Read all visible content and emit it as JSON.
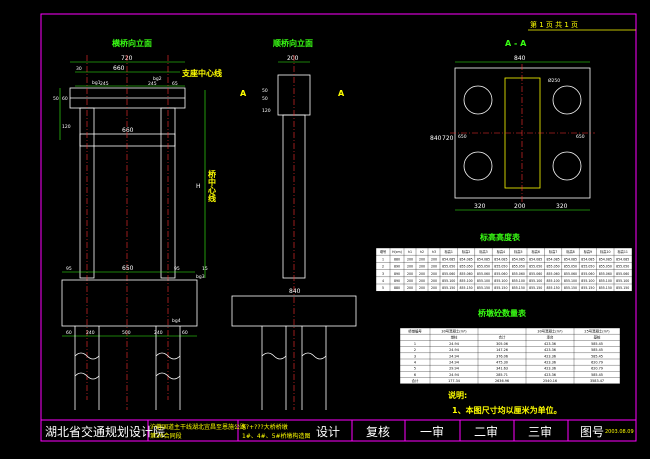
{
  "page_header": {
    "sheet": "第 1 页 共 1 页"
  },
  "views": {
    "transverse": {
      "title": "横桥向立面",
      "support_center": "支座中心线",
      "pier_center": "桥中心线",
      "height_mark": "H",
      "dims": {
        "top_width": "720",
        "top_inner": "660",
        "top_left": "30",
        "bg2_left": "245",
        "bg2_right": "245",
        "bg2_end": "65",
        "column_width": "660",
        "left_v1": "50",
        "left_v2": "60",
        "left_v3": "120",
        "base_left": "95",
        "base_mid": "650",
        "base_right": "95",
        "base_end": "15",
        "foot_a": "60",
        "foot_b": "240",
        "foot_c": "500",
        "foot_d": "240",
        "foot_e": "60"
      },
      "rebar_marks": {
        "bg1_a": "bg1",
        "bg2": "bg2",
        "bg3": "bg3",
        "bg4": "bg4"
      }
    },
    "longitudinal": {
      "title": "顺桥向立面",
      "width": "200",
      "v1": "50",
      "v2": "50",
      "v3": "120",
      "base_width": "840",
      "section_mark": "A"
    },
    "section": {
      "title": "A - A",
      "width": "840",
      "height": "840",
      "inner_h": "720",
      "left": "320",
      "mid": "200",
      "right": "320",
      "dia": "Ø250",
      "h1": "650",
      "h2": "650"
    }
  },
  "elevation_table": {
    "title": "标高高度表",
    "headers": [
      "墩号",
      "H(cm)",
      "h1",
      "h2",
      "h3",
      "标高1",
      "标高2",
      "标高3",
      "标高4",
      "标高5",
      "标高6",
      "标高7",
      "标高8",
      "标高9",
      "标高10",
      "标高11"
    ],
    "rows": [
      [
        "1",
        "880",
        "200",
        "200",
        "200",
        "854.085",
        "854.085",
        "854.085",
        "854.085",
        "854.085",
        "854.085",
        "854.085",
        "854.085",
        "854.085",
        "854.085",
        "854.085"
      ],
      [
        "2",
        "890",
        "200",
        "200",
        "200",
        "855.050",
        "855.050",
        "855.050",
        "855.050",
        "855.050",
        "855.050",
        "855.050",
        "855.050",
        "855.050",
        "855.050",
        "855.050"
      ],
      [
        "3",
        "890",
        "200",
        "200",
        "200",
        "855.060",
        "855.060",
        "855.060",
        "855.060",
        "855.060",
        "855.060",
        "855.060",
        "855.060",
        "855.060",
        "855.060",
        "855.060"
      ],
      [
        "4",
        "890",
        "200",
        "200",
        "200",
        "855.100",
        "855.100",
        "855.100",
        "855.100",
        "855.100",
        "855.100",
        "855.100",
        "855.100",
        "855.100",
        "855.100",
        "855.100"
      ],
      [
        "5",
        "880",
        "200",
        "200",
        "200",
        "855.150",
        "855.150",
        "855.150",
        "855.150",
        "855.150",
        "855.150",
        "855.150",
        "855.150",
        "855.150",
        "855.150",
        "855.150"
      ]
    ]
  },
  "quantity_table": {
    "title": "桥墩砼数量表",
    "headers": [
      "桥墩编号",
      "30号混凝土(m³)",
      "",
      "30号混凝土(m³)",
      "25号混凝土(m³)"
    ],
    "subheaders": [
      "",
      "墩柱",
      "合计",
      "承台",
      "基桩"
    ],
    "rows": [
      [
        "1",
        "24.94",
        "305.06",
        "423.36",
        "585.45"
      ],
      [
        "2",
        "24.94",
        "147.26",
        "423.36",
        "585.45"
      ],
      [
        "3",
        "24.94",
        "376.06",
        "423.36",
        "585.45"
      ],
      [
        "4",
        "24.94",
        "475.30",
        "423.36",
        "620.79"
      ],
      [
        "5",
        "29.94",
        "341.63",
        "423.36",
        "620.79"
      ],
      [
        "6",
        "24.94",
        "285.71",
        "423.36",
        "585.45"
      ],
      [
        "合计",
        "177.34",
        "2636.96",
        "2540.16",
        "3583.47"
      ]
    ]
  },
  "notes": {
    "heading": "说明:",
    "items": [
      "1、本图尺寸均以厘米为单位。"
    ]
  },
  "title_block": {
    "institute": "湖北省交通规划设计院",
    "project_1": "沪蓉国道主干线湖北宜昌至恩施公路",
    "project_2": "第30合同段",
    "drawing_1": "K?+???大桥桥墩",
    "drawing_2": "1#、4#、5#桥墩构造图",
    "design": "设计",
    "check": "复核",
    "review1": "一审",
    "review2": "二审",
    "review3": "三审",
    "drawing_no_label": "图号",
    "date": "2003.08.09"
  }
}
